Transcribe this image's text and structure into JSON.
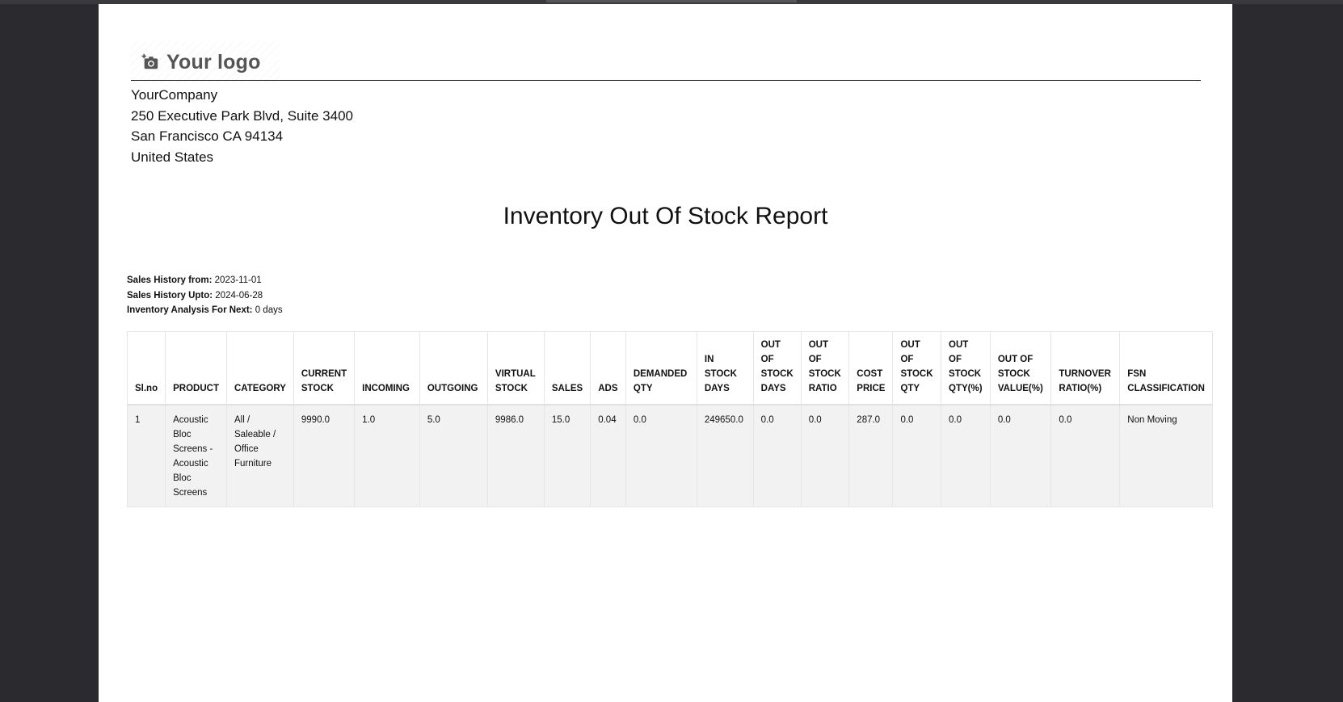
{
  "logo": {
    "text": "Your logo",
    "icon": "camera-plus-icon"
  },
  "company": {
    "name": "YourCompany",
    "street": "250 Executive Park Blvd, Suite 3400",
    "city": "San Francisco CA 94134",
    "country": "United States"
  },
  "report": {
    "title": "Inventory Out Of Stock Report"
  },
  "meta": {
    "sales_from_label": "Sales History from:",
    "sales_from_value": "2023-11-01",
    "sales_upto_label": "Sales History Upto:",
    "sales_upto_value": "2024-06-28",
    "analysis_label": "Inventory Analysis For Next:",
    "analysis_value": "0 days"
  },
  "table": {
    "headers": [
      "Sl.no",
      "PRODUCT",
      "CATEGORY",
      "CURRENT STOCK",
      "INCOMING",
      "OUTGOING",
      "VIRTUAL STOCK",
      "SALES",
      "ADS",
      "DEMANDED QTY",
      "IN STOCK DAYS",
      "OUT OF STOCK DAYS",
      "OUT OF STOCK RATIO",
      "COST PRICE",
      "OUT OF STOCK QTY",
      "OUT OF STOCK QTY(%)",
      "OUT OF STOCK VALUE(%)",
      "TURNOVER RATIO(%)",
      "FSN CLASSIFICATION"
    ],
    "rows": [
      [
        "1",
        "Acoustic Bloc Screens - Acoustic Bloc Screens",
        "All / Saleable / Office Furniture",
        "9990.0",
        "1.0",
        "5.0",
        "9986.0",
        "15.0",
        "0.04",
        "0.0",
        "249650.0",
        "0.0",
        "0.0",
        "287.0",
        "0.0",
        "0.0",
        "0.0",
        "0.0",
        "Non Moving"
      ]
    ]
  }
}
